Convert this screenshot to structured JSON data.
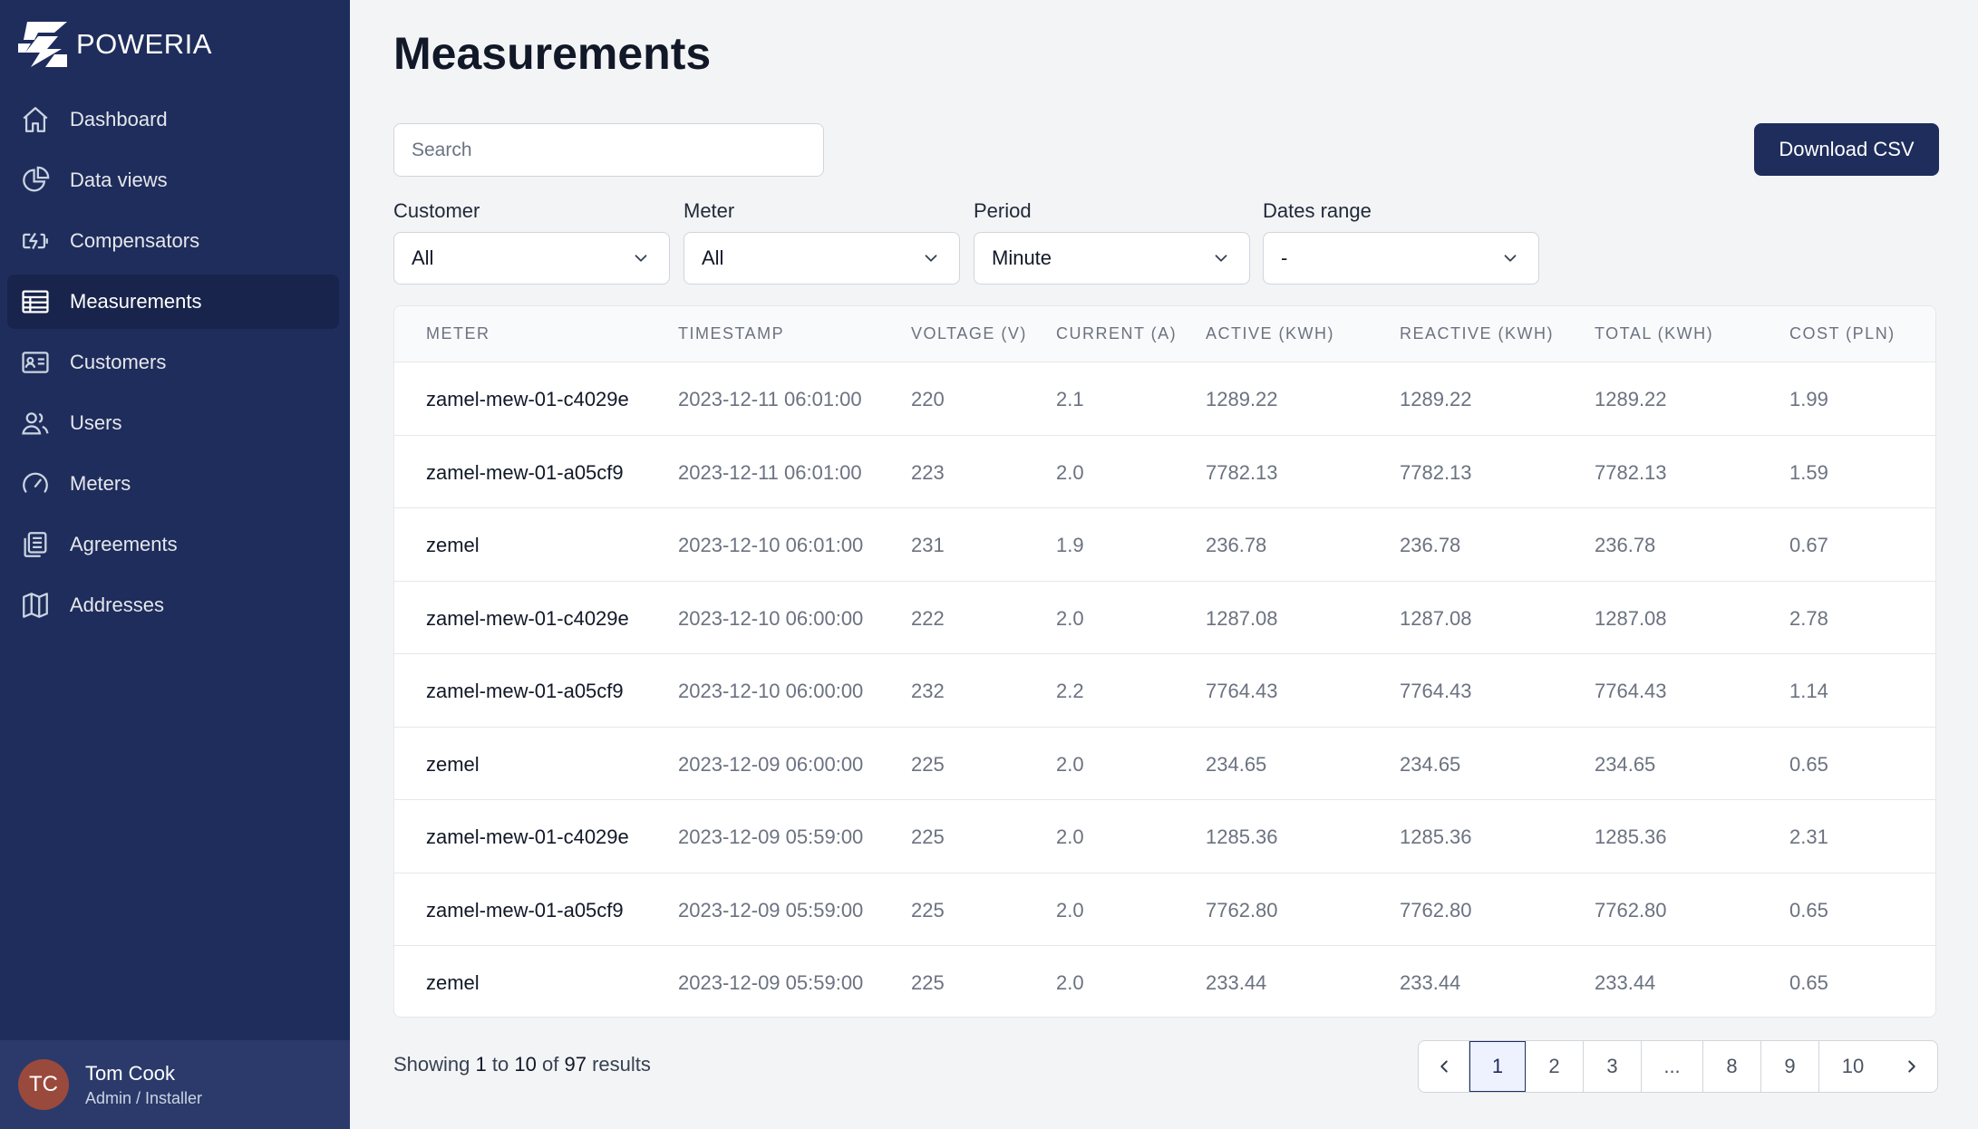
{
  "brand": {
    "name": "POWERIA"
  },
  "nav": [
    {
      "label": "Dashboard",
      "icon": "home-icon",
      "active": false
    },
    {
      "label": "Data views",
      "icon": "pie-chart-icon",
      "active": false
    },
    {
      "label": "Compensators",
      "icon": "battery-icon",
      "active": false
    },
    {
      "label": "Measurements",
      "icon": "table-icon",
      "active": true
    },
    {
      "label": "Customers",
      "icon": "id-card-icon",
      "active": false
    },
    {
      "label": "Users",
      "icon": "users-icon",
      "active": false
    },
    {
      "label": "Meters",
      "icon": "gauge-icon",
      "active": false
    },
    {
      "label": "Agreements",
      "icon": "clipboard-icon",
      "active": false
    },
    {
      "label": "Addresses",
      "icon": "map-icon",
      "active": false
    }
  ],
  "user": {
    "initials": "TC",
    "name": "Tom Cook",
    "role": "Admin / Installer"
  },
  "page": {
    "title": "Measurements"
  },
  "search": {
    "placeholder": "Search",
    "value": ""
  },
  "download_label": "Download CSV",
  "filters": [
    {
      "label": "Customer",
      "value": "All"
    },
    {
      "label": "Meter",
      "value": "All"
    },
    {
      "label": "Period",
      "value": "Minute"
    },
    {
      "label": "Dates range",
      "value": "-"
    }
  ],
  "table": {
    "columns": [
      "Meter",
      "Timestamp",
      "Voltage (V)",
      "Current (A)",
      "Active (kWh)",
      "Reactive (kWh)",
      "Total (kWh)",
      "Cost (PLN)"
    ],
    "rows": [
      [
        "zamel-mew-01-c4029e",
        "2023-12-11 06:01:00",
        "220",
        "2.1",
        "1289.22",
        "1289.22",
        "1289.22",
        "1.99"
      ],
      [
        "zamel-mew-01-a05cf9",
        "2023-12-11 06:01:00",
        "223",
        "2.0",
        "7782.13",
        "7782.13",
        "7782.13",
        "1.59"
      ],
      [
        "zemel",
        "2023-12-10 06:01:00",
        "231",
        "1.9",
        "236.78",
        "236.78",
        "236.78",
        "0.67"
      ],
      [
        "zamel-mew-01-c4029e",
        "2023-12-10 06:00:00",
        "222",
        "2.0",
        "1287.08",
        "1287.08",
        "1287.08",
        "2.78"
      ],
      [
        "zamel-mew-01-a05cf9",
        "2023-12-10 06:00:00",
        "232",
        "2.2",
        "7764.43",
        "7764.43",
        "7764.43",
        "1.14"
      ],
      [
        "zemel",
        "2023-12-09 06:00:00",
        "225",
        "2.0",
        "234.65",
        "234.65",
        "234.65",
        "0.65"
      ],
      [
        "zamel-mew-01-c4029e",
        "2023-12-09 05:59:00",
        "225",
        "2.0",
        "1285.36",
        "1285.36",
        "1285.36",
        "2.31"
      ],
      [
        "zamel-mew-01-a05cf9",
        "2023-12-09 05:59:00",
        "225",
        "2.0",
        "7762.80",
        "7762.80",
        "7762.80",
        "0.65"
      ],
      [
        "zemel",
        "2023-12-09 05:59:00",
        "225",
        "2.0",
        "233.44",
        "233.44",
        "233.44",
        "0.65"
      ]
    ]
  },
  "results": {
    "prefix": "Showing",
    "from": "1",
    "to_word": "to",
    "to": "10",
    "of_word": "of",
    "total": "97",
    "suffix": "results"
  },
  "pagination": {
    "pages": [
      "1",
      "2",
      "3",
      "...",
      "8",
      "9",
      "10"
    ],
    "current": "1"
  },
  "colors": {
    "sidebar": "#1f2d5c",
    "sidebar_active": "#18244b",
    "primary": "#1f2d5c",
    "avatar": "#9a4a3c"
  }
}
